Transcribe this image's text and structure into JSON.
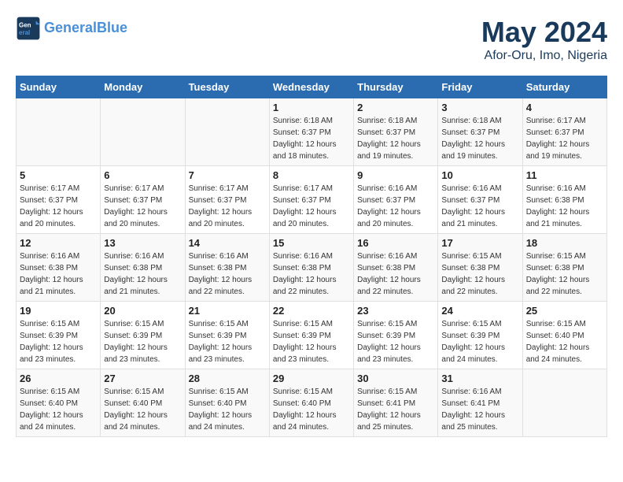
{
  "header": {
    "logo_line1": "General",
    "logo_line2": "Blue",
    "title": "May 2024",
    "subtitle": "Afor-Oru, Imo, Nigeria"
  },
  "days_of_week": [
    "Sunday",
    "Monday",
    "Tuesday",
    "Wednesday",
    "Thursday",
    "Friday",
    "Saturday"
  ],
  "weeks": [
    [
      {
        "num": "",
        "info": ""
      },
      {
        "num": "",
        "info": ""
      },
      {
        "num": "",
        "info": ""
      },
      {
        "num": "1",
        "info": "Sunrise: 6:18 AM\nSunset: 6:37 PM\nDaylight: 12 hours\nand 18 minutes."
      },
      {
        "num": "2",
        "info": "Sunrise: 6:18 AM\nSunset: 6:37 PM\nDaylight: 12 hours\nand 19 minutes."
      },
      {
        "num": "3",
        "info": "Sunrise: 6:18 AM\nSunset: 6:37 PM\nDaylight: 12 hours\nand 19 minutes."
      },
      {
        "num": "4",
        "info": "Sunrise: 6:17 AM\nSunset: 6:37 PM\nDaylight: 12 hours\nand 19 minutes."
      }
    ],
    [
      {
        "num": "5",
        "info": "Sunrise: 6:17 AM\nSunset: 6:37 PM\nDaylight: 12 hours\nand 20 minutes."
      },
      {
        "num": "6",
        "info": "Sunrise: 6:17 AM\nSunset: 6:37 PM\nDaylight: 12 hours\nand 20 minutes."
      },
      {
        "num": "7",
        "info": "Sunrise: 6:17 AM\nSunset: 6:37 PM\nDaylight: 12 hours\nand 20 minutes."
      },
      {
        "num": "8",
        "info": "Sunrise: 6:17 AM\nSunset: 6:37 PM\nDaylight: 12 hours\nand 20 minutes."
      },
      {
        "num": "9",
        "info": "Sunrise: 6:16 AM\nSunset: 6:37 PM\nDaylight: 12 hours\nand 20 minutes."
      },
      {
        "num": "10",
        "info": "Sunrise: 6:16 AM\nSunset: 6:37 PM\nDaylight: 12 hours\nand 21 minutes."
      },
      {
        "num": "11",
        "info": "Sunrise: 6:16 AM\nSunset: 6:38 PM\nDaylight: 12 hours\nand 21 minutes."
      }
    ],
    [
      {
        "num": "12",
        "info": "Sunrise: 6:16 AM\nSunset: 6:38 PM\nDaylight: 12 hours\nand 21 minutes."
      },
      {
        "num": "13",
        "info": "Sunrise: 6:16 AM\nSunset: 6:38 PM\nDaylight: 12 hours\nand 21 minutes."
      },
      {
        "num": "14",
        "info": "Sunrise: 6:16 AM\nSunset: 6:38 PM\nDaylight: 12 hours\nand 22 minutes."
      },
      {
        "num": "15",
        "info": "Sunrise: 6:16 AM\nSunset: 6:38 PM\nDaylight: 12 hours\nand 22 minutes."
      },
      {
        "num": "16",
        "info": "Sunrise: 6:16 AM\nSunset: 6:38 PM\nDaylight: 12 hours\nand 22 minutes."
      },
      {
        "num": "17",
        "info": "Sunrise: 6:15 AM\nSunset: 6:38 PM\nDaylight: 12 hours\nand 22 minutes."
      },
      {
        "num": "18",
        "info": "Sunrise: 6:15 AM\nSunset: 6:38 PM\nDaylight: 12 hours\nand 22 minutes."
      }
    ],
    [
      {
        "num": "19",
        "info": "Sunrise: 6:15 AM\nSunset: 6:39 PM\nDaylight: 12 hours\nand 23 minutes."
      },
      {
        "num": "20",
        "info": "Sunrise: 6:15 AM\nSunset: 6:39 PM\nDaylight: 12 hours\nand 23 minutes."
      },
      {
        "num": "21",
        "info": "Sunrise: 6:15 AM\nSunset: 6:39 PM\nDaylight: 12 hours\nand 23 minutes."
      },
      {
        "num": "22",
        "info": "Sunrise: 6:15 AM\nSunset: 6:39 PM\nDaylight: 12 hours\nand 23 minutes."
      },
      {
        "num": "23",
        "info": "Sunrise: 6:15 AM\nSunset: 6:39 PM\nDaylight: 12 hours\nand 23 minutes."
      },
      {
        "num": "24",
        "info": "Sunrise: 6:15 AM\nSunset: 6:39 PM\nDaylight: 12 hours\nand 24 minutes."
      },
      {
        "num": "25",
        "info": "Sunrise: 6:15 AM\nSunset: 6:40 PM\nDaylight: 12 hours\nand 24 minutes."
      }
    ],
    [
      {
        "num": "26",
        "info": "Sunrise: 6:15 AM\nSunset: 6:40 PM\nDaylight: 12 hours\nand 24 minutes."
      },
      {
        "num": "27",
        "info": "Sunrise: 6:15 AM\nSunset: 6:40 PM\nDaylight: 12 hours\nand 24 minutes."
      },
      {
        "num": "28",
        "info": "Sunrise: 6:15 AM\nSunset: 6:40 PM\nDaylight: 12 hours\nand 24 minutes."
      },
      {
        "num": "29",
        "info": "Sunrise: 6:15 AM\nSunset: 6:40 PM\nDaylight: 12 hours\nand 24 minutes."
      },
      {
        "num": "30",
        "info": "Sunrise: 6:15 AM\nSunset: 6:41 PM\nDaylight: 12 hours\nand 25 minutes."
      },
      {
        "num": "31",
        "info": "Sunrise: 6:16 AM\nSunset: 6:41 PM\nDaylight: 12 hours\nand 25 minutes."
      },
      {
        "num": "",
        "info": ""
      }
    ]
  ]
}
